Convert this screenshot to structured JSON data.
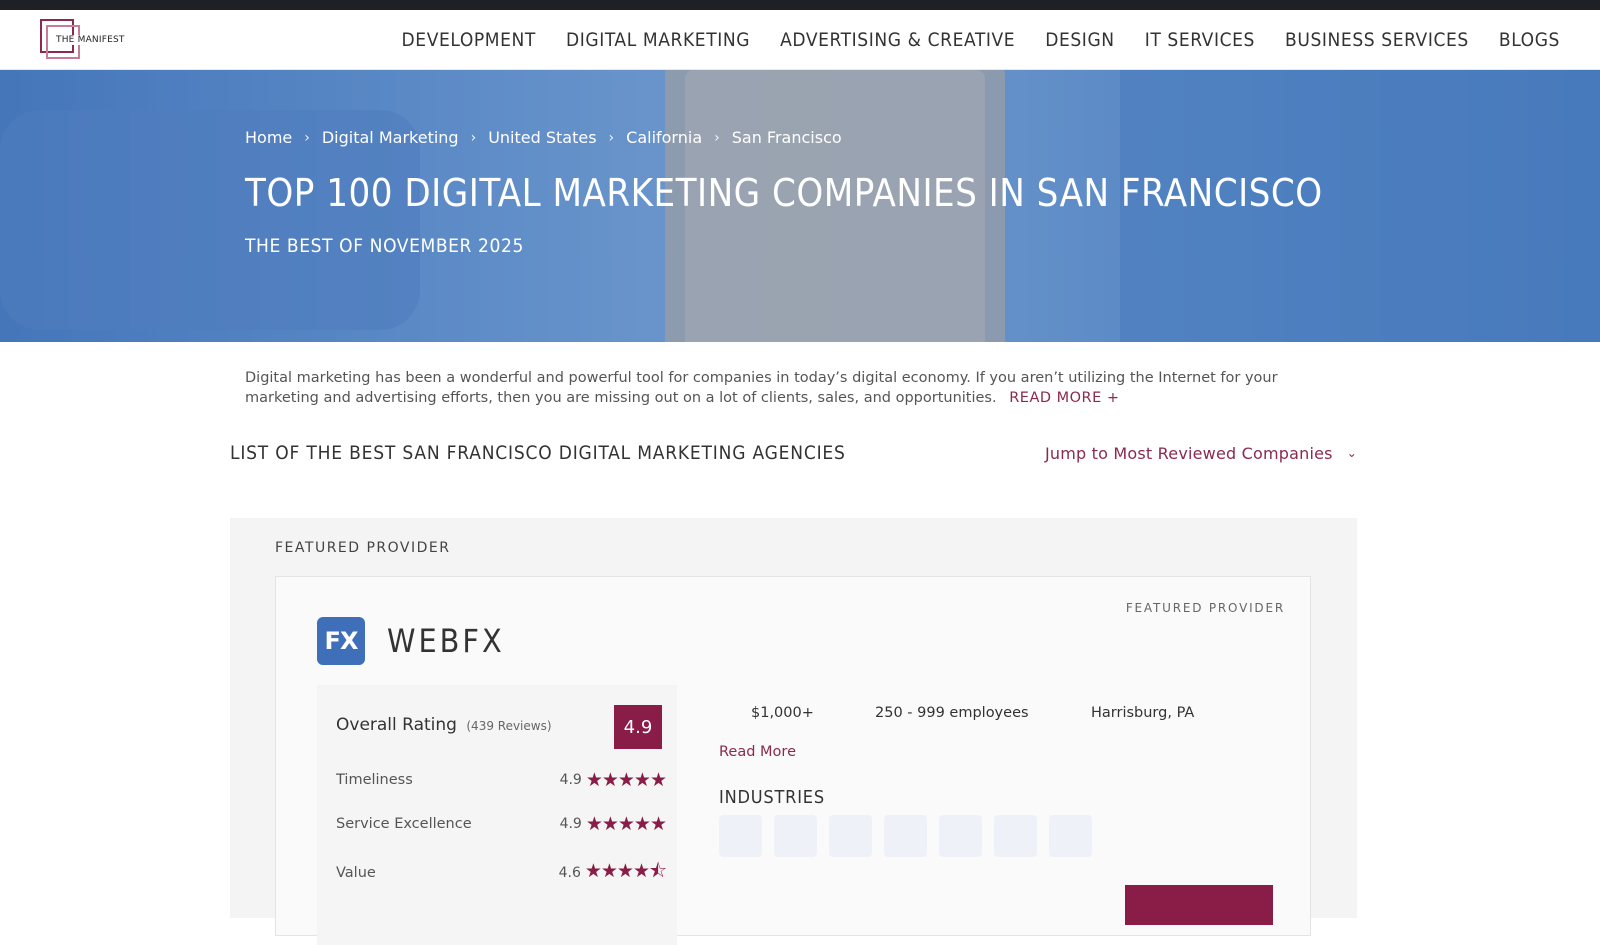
{
  "nav": {
    "logo_text": "THE MANIFEST",
    "links": [
      "DEVELOPMENT",
      "DIGITAL MARKETING",
      "ADVERTISING & CREATIVE",
      "DESIGN",
      "IT SERVICES",
      "BUSINESS SERVICES",
      "BLOGS"
    ]
  },
  "hero": {
    "breadcrumb": [
      "Home",
      "Digital Marketing",
      "United States",
      "California",
      "San Francisco"
    ],
    "title": "TOP 100 DIGITAL MARKETING COMPANIES IN SAN FRANCISCO",
    "subtitle": "THE BEST OF NOVEMBER 2025"
  },
  "intro": {
    "text": "Digital marketing has been a wonderful and powerful tool for companies in today’s digital economy. If you aren’t utilizing the Internet for your marketing and advertising efforts, then you are missing out on a lot of clients, sales, and opportunities.",
    "read_more": "READ MORE +"
  },
  "list": {
    "heading": "LIST OF THE BEST SAN FRANCISCO DIGITAL MARKETING AGENCIES",
    "jump_label": "Jump to Most Reviewed Companies"
  },
  "featured": {
    "section_label": "FEATURED PROVIDER",
    "card_badge": "FEATURED PROVIDER",
    "company_logo_text": "FX",
    "company_name": "WEBFX",
    "overall_label": "Overall Rating",
    "reviews": "(439 Reviews)",
    "overall_score": "4.9",
    "ratings": [
      {
        "label": "Timeliness",
        "value": "4.9",
        "stars": 4.9
      },
      {
        "label": "Service Excellence",
        "value": "4.9",
        "stars": 4.9
      },
      {
        "label": "Value",
        "value": "4.6",
        "stars": 4.6
      }
    ],
    "min_project": "$1,000+",
    "employees": "250 - 999 employees",
    "location": "Harrisburg, PA",
    "read_more": "Read More",
    "industries_label": "INDUSTRIES"
  },
  "colors": {
    "accent": "#8a1c48",
    "hero_blue": "#5a88c6"
  }
}
